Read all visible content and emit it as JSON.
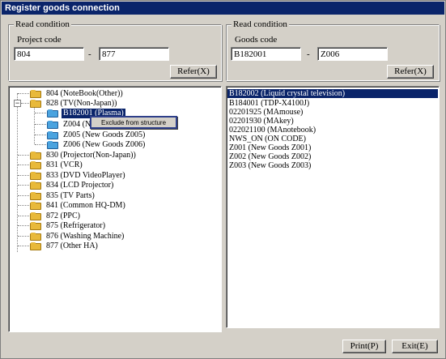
{
  "window": {
    "title": "Register goods connection"
  },
  "left_condition": {
    "legend": "Read condition",
    "field_label": "Project code",
    "from_value": "804",
    "separator": "-",
    "to_value": "877",
    "refer_button": "Refer(X)"
  },
  "right_condition": {
    "legend": "Read condition",
    "field_label": "Goods code",
    "from_value": "B182001",
    "separator": "-",
    "to_value": "Z006",
    "refer_button": "Refer(X)"
  },
  "tree": {
    "items": [
      {
        "label": "804 (NoteBook(Other))",
        "icon": "folder-yellow"
      },
      {
        "label": "828 (TV(Non-Japan))",
        "icon": "folder-yellow",
        "expanded": true
      },
      {
        "label": "B182001 (Plasma)",
        "icon": "folder-blue",
        "selected": true
      },
      {
        "label": "Z004 (N",
        "icon": "folder-blue"
      },
      {
        "label": "Z005 (New Goods Z005)",
        "icon": "folder-blue"
      },
      {
        "label": "Z006 (New Goods Z006)",
        "icon": "folder-blue"
      },
      {
        "label": "830 (Projector(Non-Japan))",
        "icon": "folder-yellow"
      },
      {
        "label": "831 (VCR)",
        "icon": "folder-yellow"
      },
      {
        "label": "833 (DVD VideoPlayer)",
        "icon": "folder-yellow"
      },
      {
        "label": "834 (LCD Projector)",
        "icon": "folder-yellow"
      },
      {
        "label": "835 (TV Parts)",
        "icon": "folder-yellow"
      },
      {
        "label": "841 (Common HQ-DM)",
        "icon": "folder-yellow"
      },
      {
        "label": "872 (PPC)",
        "icon": "folder-yellow"
      },
      {
        "label": "875 (Refrigerator)",
        "icon": "folder-yellow"
      },
      {
        "label": "876 (Washing Machine)",
        "icon": "folder-yellow"
      },
      {
        "label": "877 (Other HA)",
        "icon": "folder-yellow"
      }
    ],
    "expander_symbol": "−"
  },
  "context_menu": {
    "items": [
      "Exclude from structure"
    ]
  },
  "goods_list": {
    "items": [
      "B182002 (Liquid crystal television)",
      "B184001 (TDP-X4100J)",
      "02201925 (MAmouse)",
      "02201930 (MAkey)",
      "022021100 (MAnotebook)",
      "NWS_ON (ON CODE)",
      "Z001 (New Goods Z001)",
      "Z002 (New Goods Z002)",
      "Z003 (New Goods Z003)"
    ]
  },
  "footer": {
    "print_button": "Print(P)",
    "exit_button": "Exit(E)"
  }
}
